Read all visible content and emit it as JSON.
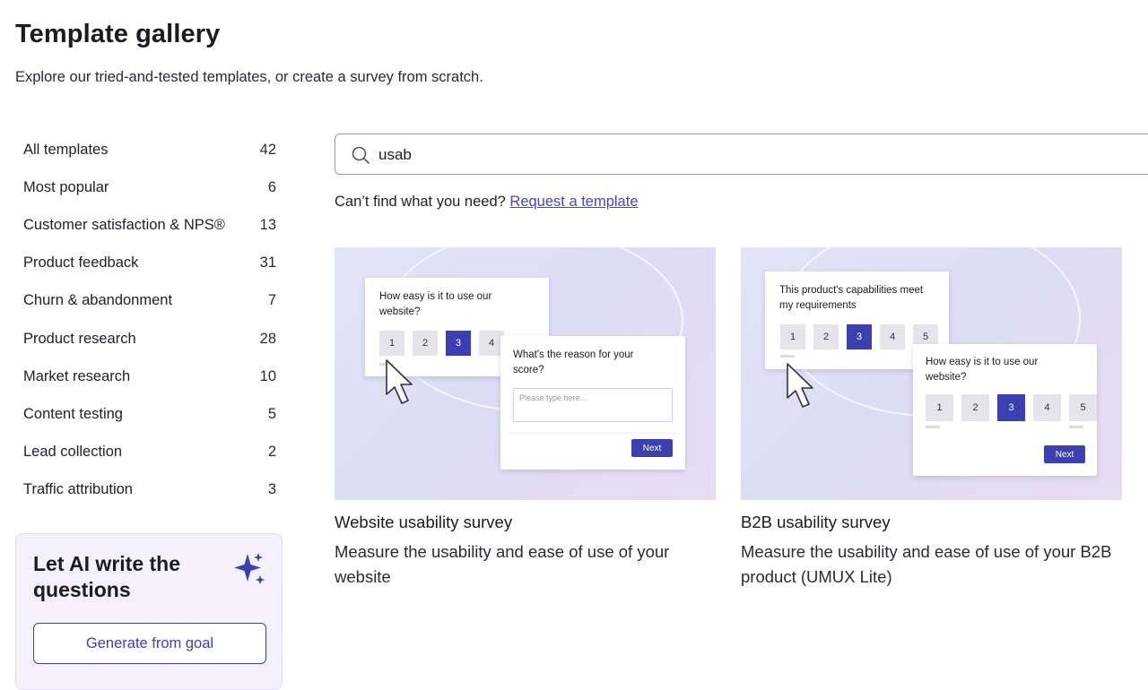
{
  "header": {
    "title": "Template gallery",
    "subtitle": "Explore our tried-and-tested templates, or create a survey from scratch."
  },
  "sidebar": {
    "categories": [
      {
        "label": "All templates",
        "count": "42"
      },
      {
        "label": "Most popular",
        "count": "6"
      },
      {
        "label": "Customer satisfaction & NPS®",
        "count": "13"
      },
      {
        "label": "Product feedback",
        "count": "31"
      },
      {
        "label": "Churn & abandonment",
        "count": "7"
      },
      {
        "label": "Product research",
        "count": "28"
      },
      {
        "label": "Market research",
        "count": "10"
      },
      {
        "label": "Content testing",
        "count": "5"
      },
      {
        "label": "Lead collection",
        "count": "2"
      },
      {
        "label": "Traffic attribution",
        "count": "3"
      }
    ],
    "ai_card": {
      "title": "Let AI write the questions",
      "button_label": "Generate from goal",
      "icon": "sparkle-icon"
    }
  },
  "search": {
    "value": "usab",
    "icon": "search-icon"
  },
  "help": {
    "text": "Can’t find what you need?",
    "link": "Request a template"
  },
  "templates": [
    {
      "title": "Website usability survey",
      "description": "Measure the usability and ease of use of your website",
      "preview": {
        "question1": "How easy is it to use our website?",
        "scale": [
          "1",
          "2",
          "3",
          "4"
        ],
        "selected": "3",
        "question2": "What's the reason for your score?",
        "placeholder": "Please type here...",
        "next": "Next"
      }
    },
    {
      "title": "B2B usability survey",
      "description": "Measure the usability and ease of use of your B2B product (UMUX Lite)",
      "preview": {
        "question1": "This product's capabilities meet my requirements",
        "scale": [
          "1",
          "2",
          "3",
          "4",
          "5"
        ],
        "selected": "3",
        "question2": "How easy is it to use our website?",
        "scale2": [
          "1",
          "2",
          "3",
          "4",
          "5"
        ],
        "next": "Next"
      }
    }
  ],
  "colors": {
    "accent": "#3b3fb0",
    "link": "#4a43c9",
    "ai_card_bg": "#f4f1fd"
  }
}
